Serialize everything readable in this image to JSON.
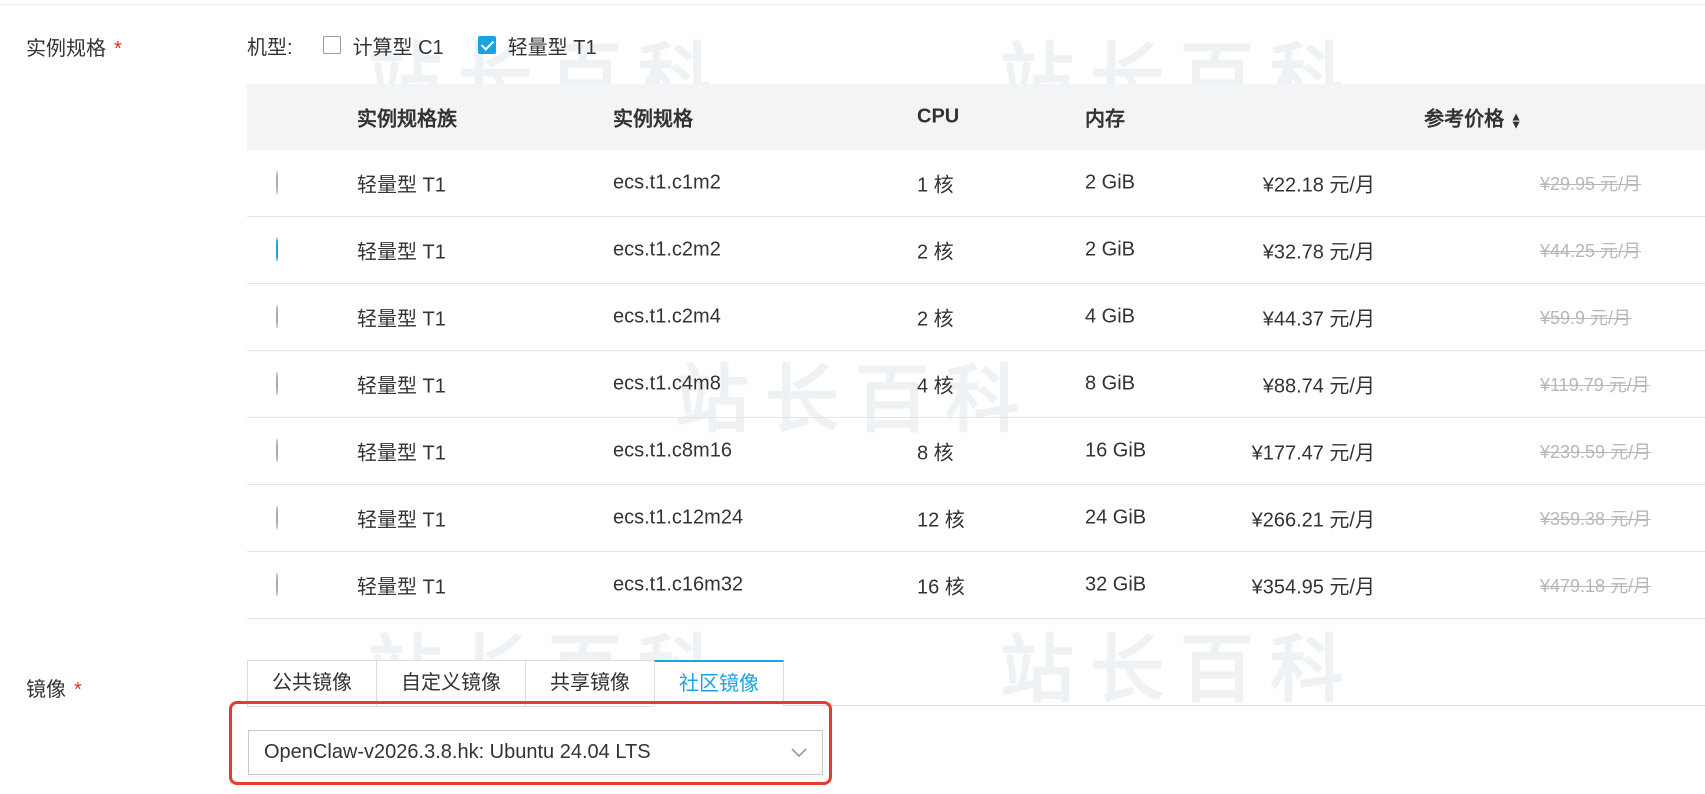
{
  "watermark": "站长百科",
  "spec": {
    "label": "实例规格",
    "required_mark": "*",
    "machine_type_label": "机型:",
    "machine_types": [
      {
        "label": "计算型 C1",
        "checked": false
      },
      {
        "label": "轻量型 T1",
        "checked": true
      }
    ]
  },
  "table": {
    "headers": {
      "family": "实例规格族",
      "spec": "实例规格",
      "cpu": "CPU",
      "memory": "内存",
      "price": "参考价格"
    },
    "rows": [
      {
        "selected": false,
        "family": "轻量型 T1",
        "spec": "ecs.t1.c1m2",
        "cpu": "1 核",
        "memory": "2 GiB",
        "price": "¥22.18 元/月",
        "original_price": "¥29.95 元/月"
      },
      {
        "selected": true,
        "family": "轻量型 T1",
        "spec": "ecs.t1.c2m2",
        "cpu": "2 核",
        "memory": "2 GiB",
        "price": "¥32.78 元/月",
        "original_price": "¥44.25 元/月"
      },
      {
        "selected": false,
        "family": "轻量型 T1",
        "spec": "ecs.t1.c2m4",
        "cpu": "2 核",
        "memory": "4 GiB",
        "price": "¥44.37 元/月",
        "original_price": "¥59.9 元/月"
      },
      {
        "selected": false,
        "family": "轻量型 T1",
        "spec": "ecs.t1.c4m8",
        "cpu": "4 核",
        "memory": "8 GiB",
        "price": "¥88.74 元/月",
        "original_price": "¥119.79 元/月"
      },
      {
        "selected": false,
        "family": "轻量型 T1",
        "spec": "ecs.t1.c8m16",
        "cpu": "8 核",
        "memory": "16 GiB",
        "price": "¥177.47 元/月",
        "original_price": "¥239.59 元/月"
      },
      {
        "selected": false,
        "family": "轻量型 T1",
        "spec": "ecs.t1.c12m24",
        "cpu": "12 核",
        "memory": "24 GiB",
        "price": "¥266.21 元/月",
        "original_price": "¥359.38 元/月"
      },
      {
        "selected": false,
        "family": "轻量型 T1",
        "spec": "ecs.t1.c16m32",
        "cpu": "16 核",
        "memory": "32 GiB",
        "price": "¥354.95 元/月",
        "original_price": "¥479.18 元/月"
      }
    ]
  },
  "image": {
    "label": "镜像",
    "required_mark": "*",
    "tabs": [
      {
        "label": "公共镜像",
        "active": false
      },
      {
        "label": "自定义镜像",
        "active": false
      },
      {
        "label": "共享镜像",
        "active": false
      },
      {
        "label": "社区镜像",
        "active": true
      }
    ],
    "selected_value": "OpenClaw-v2026.3.8.hk: Ubuntu 24.04 LTS"
  },
  "colors": {
    "accent": "#1ba2e0",
    "required": "#e0301e",
    "highlight_box": "#e53b30",
    "header_bg": "#f3f4f6",
    "strikethrough": "#b7b7b7"
  },
  "icons": {
    "sort": "sort-icon",
    "select_arrow": "chevron-down-icon",
    "checkbox_check": "check-icon"
  }
}
